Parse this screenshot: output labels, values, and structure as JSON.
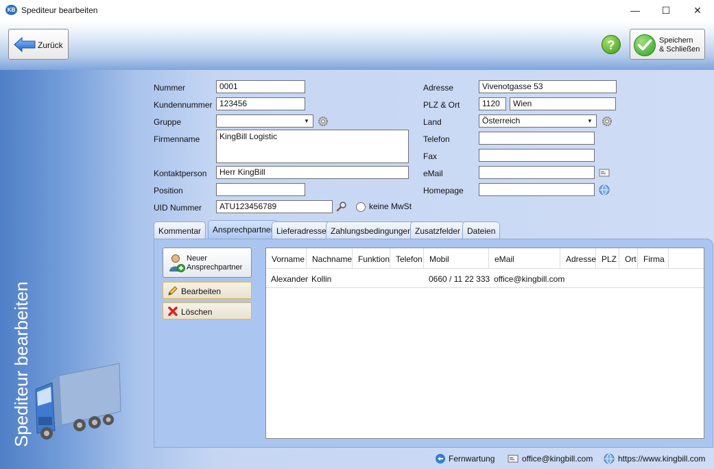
{
  "window": {
    "title": "Spediteur bearbeiten",
    "logo_text": "KB",
    "minimize": "—",
    "maximize": "☐",
    "close": "✕"
  },
  "toolbar": {
    "back_label": "Zurück",
    "help_glyph": "?",
    "save_label_line1": "Speichern",
    "save_label_line2": "& Schließen"
  },
  "sidebar": {
    "title": "Spediteur bearbeiten"
  },
  "form_left": {
    "nummer_label": "Nummer",
    "nummer_value": "0001",
    "kundennummer_label": "Kundennummer",
    "kundennummer_value": "123456",
    "gruppe_label": "Gruppe",
    "gruppe_value": "",
    "firmenname_label": "Firmenname",
    "firmenname_value": "KingBill Logistic",
    "kontaktperson_label": "Kontaktperson",
    "kontaktperson_value": "Herr KingBill",
    "position_label": "Position",
    "position_value": "",
    "uid_label": "UID Nummer",
    "uid_value": "ATU123456789",
    "keine_mwst_label": "keine MwSt"
  },
  "form_right": {
    "adresse_label": "Adresse",
    "adresse_value": "Vivenotgasse 53",
    "plz_ort_label": "PLZ & Ort",
    "plz_value": "1120",
    "ort_value": "Wien",
    "land_label": "Land",
    "land_value": "Österreich",
    "telefon_label": "Telefon",
    "telefon_value": "",
    "fax_label": "Fax",
    "fax_value": "",
    "email_label": "eMail",
    "email_value": "",
    "homepage_label": "Homepage",
    "homepage_value": ""
  },
  "tabs": [
    {
      "label": "Kommentar",
      "active": false
    },
    {
      "label": "Ansprechpartner",
      "active": true
    },
    {
      "label": "Lieferadresse",
      "active": false
    },
    {
      "label": "Zahlungsbedingungen",
      "active": false
    },
    {
      "label": "Zusatzfelder",
      "active": false
    },
    {
      "label": "Dateien",
      "active": false
    }
  ],
  "actions": {
    "new_line1": "Neuer",
    "new_line2": "Ansprechpartner",
    "edit": "Bearbeiten",
    "delete": "Löschen"
  },
  "grid": {
    "columns": [
      "Vorname",
      "Nachname",
      "Funktion",
      "Telefon",
      "Mobil",
      "eMail",
      "Adresse",
      "PLZ",
      "Ort",
      "Firma"
    ],
    "rows": [
      [
        "Alexander",
        "Kollin",
        "",
        "",
        "0660 / 11 22 333",
        "office@kingbill.com",
        "",
        "",
        "",
        ""
      ]
    ]
  },
  "footer": {
    "remote": "Fernwartung",
    "email": "office@kingbill.com",
    "web": "https://www.kingbill.com"
  },
  "colors": {
    "accent_blue": "#4f7fc6",
    "panel_blue": "#aac6f0",
    "button_border_yellow": "#e0b44a"
  }
}
